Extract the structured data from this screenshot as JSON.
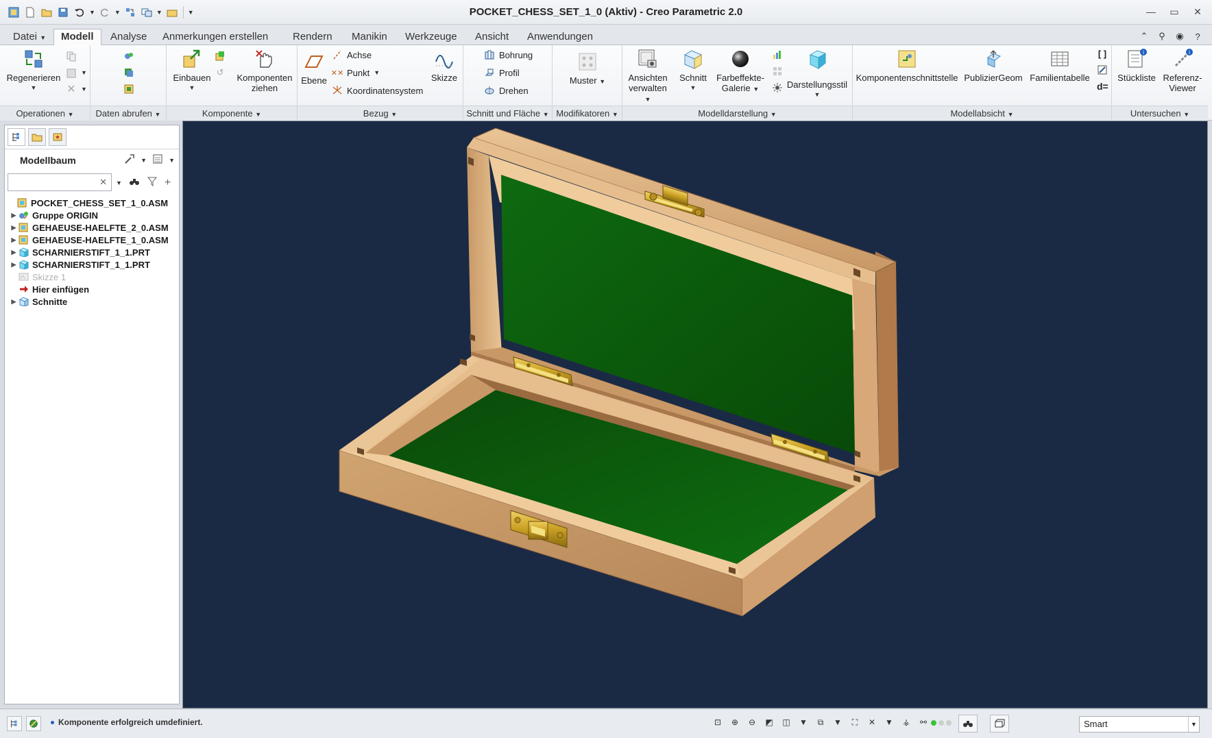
{
  "window": {
    "title": "POCKET_CHESS_SET_1_0 (Aktiv) - Creo Parametric 2.0"
  },
  "tabs": [
    {
      "label": "Datei"
    },
    {
      "label": "Modell",
      "active": true
    },
    {
      "label": "Analyse"
    },
    {
      "label": "Anmerkungen erstellen"
    },
    {
      "label": "Rendern"
    },
    {
      "label": "Manikin"
    },
    {
      "label": "Werkzeuge"
    },
    {
      "label": "Ansicht"
    },
    {
      "label": "Anwendungen"
    }
  ],
  "ribbon": {
    "operationen": {
      "regenerieren": "Regenerieren",
      "label": "Operationen"
    },
    "daten_abrufen": {
      "label": "Daten abrufen"
    },
    "komponente": {
      "einbauen": "Einbauen",
      "komponenten_ziehen_1": "Komponenten",
      "komponenten_ziehen_2": "ziehen",
      "label": "Komponente"
    },
    "bezug": {
      "ebene": "Ebene",
      "achse": "Achse",
      "punkt": "Punkt",
      "koordinatensystem": "Koordinatensystem",
      "skizze": "Skizze",
      "label": "Bezug"
    },
    "schnitt_flaeche": {
      "bohrung": "Bohrung",
      "profil": "Profil",
      "drehen": "Drehen",
      "label": "Schnitt und Fläche"
    },
    "modifikatoren": {
      "muster": "Muster",
      "label": "Modifikatoren"
    },
    "modelldarstellung": {
      "ansichten_1": "Ansichten",
      "ansichten_2": "verwalten",
      "schnitt": "Schnitt",
      "farbeffekte_1": "Farbeffekte-",
      "farbeffekte_2": "Galerie",
      "darstellungsstil": "Darstellungsstil",
      "label": "Modelldarstellung"
    },
    "modellabsicht": {
      "komponentenschnittstelle": "Komponentenschnittstelle",
      "publiziergeom": "PublizierGeom",
      "familientabelle": "Familientabelle",
      "d_eq": "d=",
      "label": "Modellabsicht"
    },
    "untersuchen": {
      "stueckliste": "Stückliste",
      "referenz_1": "Referenz-",
      "referenz_2": "Viewer",
      "label": "Untersuchen"
    }
  },
  "modelltree": {
    "title": "Modellbaum",
    "search_value": "",
    "items": [
      {
        "label": "POCKET_CHESS_SET_1_0.ASM",
        "icon": "assembly-icon",
        "expand": false,
        "indent": 0
      },
      {
        "label": "Gruppe ORIGIN",
        "icon": "group-icon",
        "expand": true,
        "indent": 1
      },
      {
        "label": "GEHAEUSE-HAELFTE_2_0.ASM",
        "icon": "assembly-icon",
        "expand": true,
        "indent": 1
      },
      {
        "label": "GEHAEUSE-HAELFTE_1_0.ASM",
        "icon": "assembly-icon",
        "expand": true,
        "indent": 1
      },
      {
        "label": "SCHARNIERSTIFT_1_1.PRT",
        "icon": "part-icon",
        "expand": true,
        "indent": 1
      },
      {
        "label": "SCHARNIERSTIFT_1_1.PRT",
        "icon": "part-icon",
        "expand": true,
        "indent": 1
      },
      {
        "label": "Skizze 1",
        "icon": "sketch-icon",
        "expand": false,
        "indent": 1,
        "dim": true
      },
      {
        "label": "Hier einfügen",
        "icon": "insert-arrow-icon",
        "expand": false,
        "indent": 1
      },
      {
        "label": "Schnitte",
        "icon": "sections-icon",
        "expand": true,
        "indent": 1
      }
    ]
  },
  "status": {
    "message": "Komponente erfolgreich umdefiniert.",
    "filter_value": "Smart"
  },
  "colors": {
    "viewport_bg": "#1a2a44",
    "wood_light": "#e9c495",
    "wood_mid": "#d7a874",
    "felt_green": "#0b5a0b",
    "brass": "#c9a024"
  }
}
